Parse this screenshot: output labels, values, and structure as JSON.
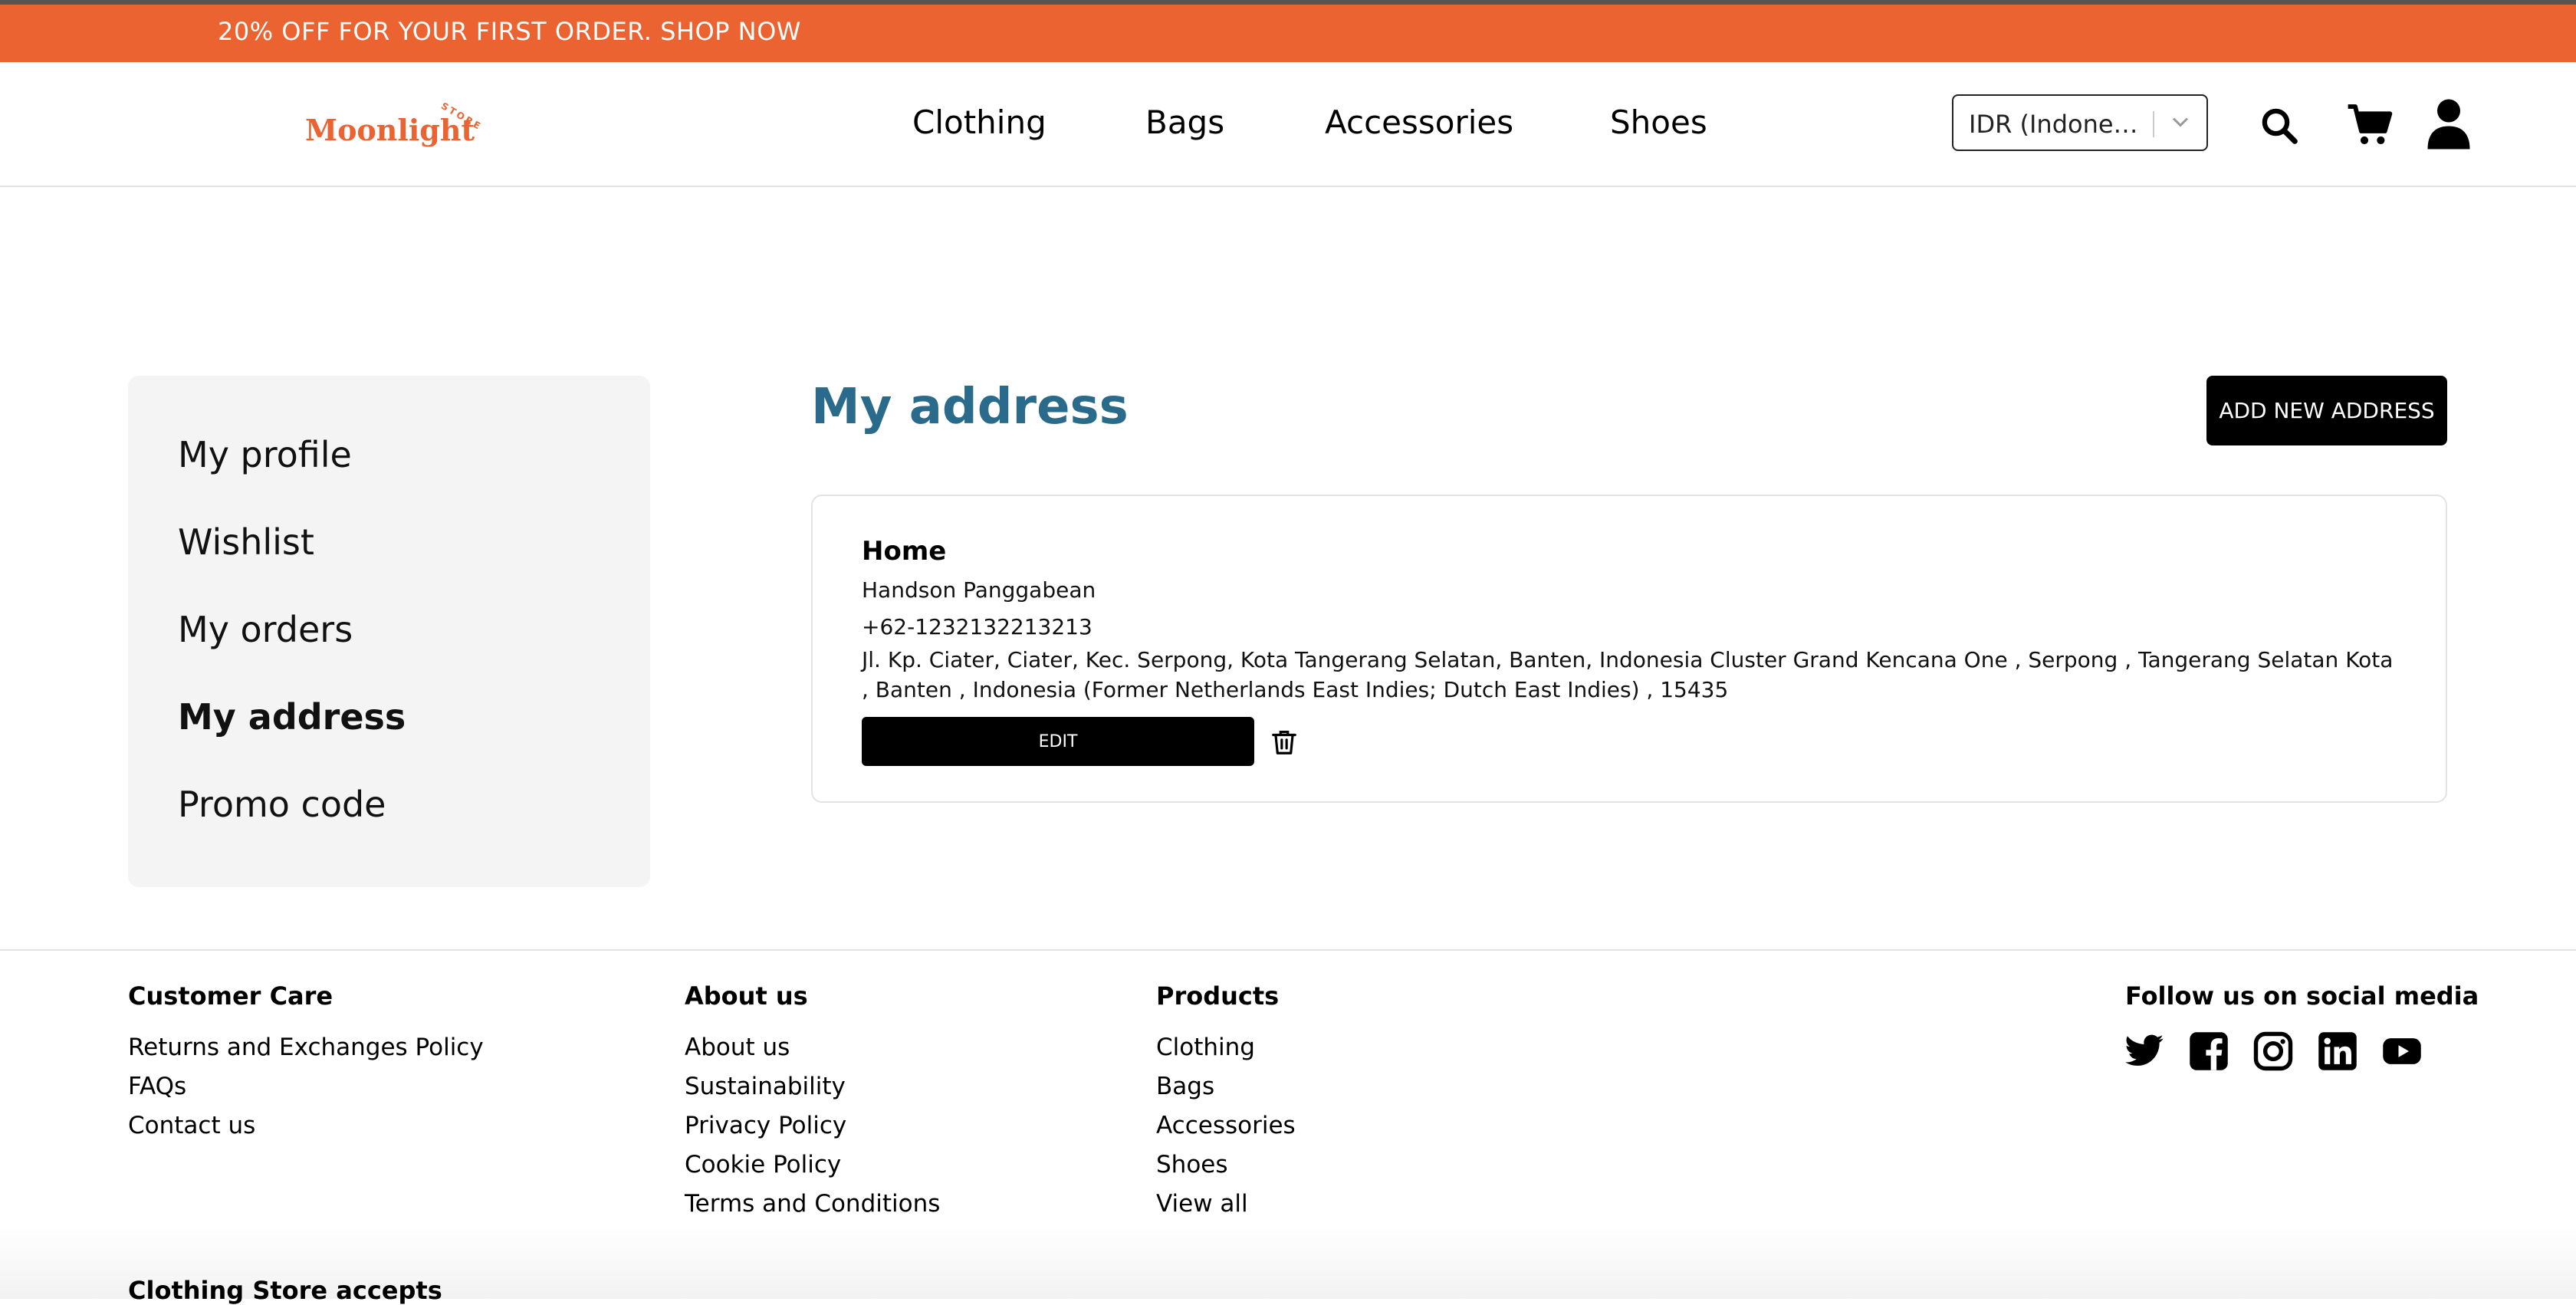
{
  "promo_bar": {
    "text": "20% OFF FOR YOUR FIRST ORDER. SHOP NOW"
  },
  "header": {
    "logo": {
      "word": "Moonlight",
      "tag": "STORE"
    },
    "nav": [
      "Clothing",
      "Bags",
      "Accessories",
      "Shoes"
    ],
    "currency": {
      "value": "IDR (Indone…"
    },
    "icons": [
      "search-icon",
      "cart-icon",
      "user-icon"
    ]
  },
  "sidebar": {
    "items": [
      {
        "label": "My profile"
      },
      {
        "label": "Wishlist"
      },
      {
        "label": "My orders"
      },
      {
        "label": "My address"
      },
      {
        "label": "Promo code"
      }
    ],
    "active": "My address"
  },
  "main": {
    "title": "My address",
    "add_button": "ADD NEW ADDRESS",
    "address": {
      "label": "Home",
      "name": "Handson Panggabean",
      "phone": "+62-1232132213213",
      "address_text": "Jl. Kp. Ciater, Ciater, Kec. Serpong, Kota Tangerang Selatan, Banten, Indonesia Cluster Grand Kencana One , Serpong , Tangerang Selatan Kota , Banten , Indonesia (Former Netherlands East Indies; Dutch East Indies) , 15435",
      "edit_button": "EDIT"
    }
  },
  "footer": {
    "customer_care": {
      "heading": "Customer Care",
      "links": [
        "Returns and Exchanges Policy",
        "FAQs",
        "Contact us"
      ]
    },
    "about": {
      "heading": "About us",
      "links": [
        "About us",
        "Sustainability",
        "Privacy Policy",
        "Cookie Policy",
        "Terms and Conditions"
      ]
    },
    "products": {
      "heading": "Products",
      "links": [
        "Clothing",
        "Bags",
        "Accessories",
        "Shoes",
        "View all"
      ]
    },
    "social": {
      "heading": "Follow us on social media",
      "icons": [
        "twitter-icon",
        "facebook-icon",
        "instagram-icon",
        "linkedin-icon",
        "youtube-icon"
      ]
    },
    "accepts_heading": "Clothing Store accepts"
  },
  "colors": {
    "accent": "#EB6331",
    "title": "#2A6A8A",
    "sidebar_bg": "#F4F4F4"
  }
}
